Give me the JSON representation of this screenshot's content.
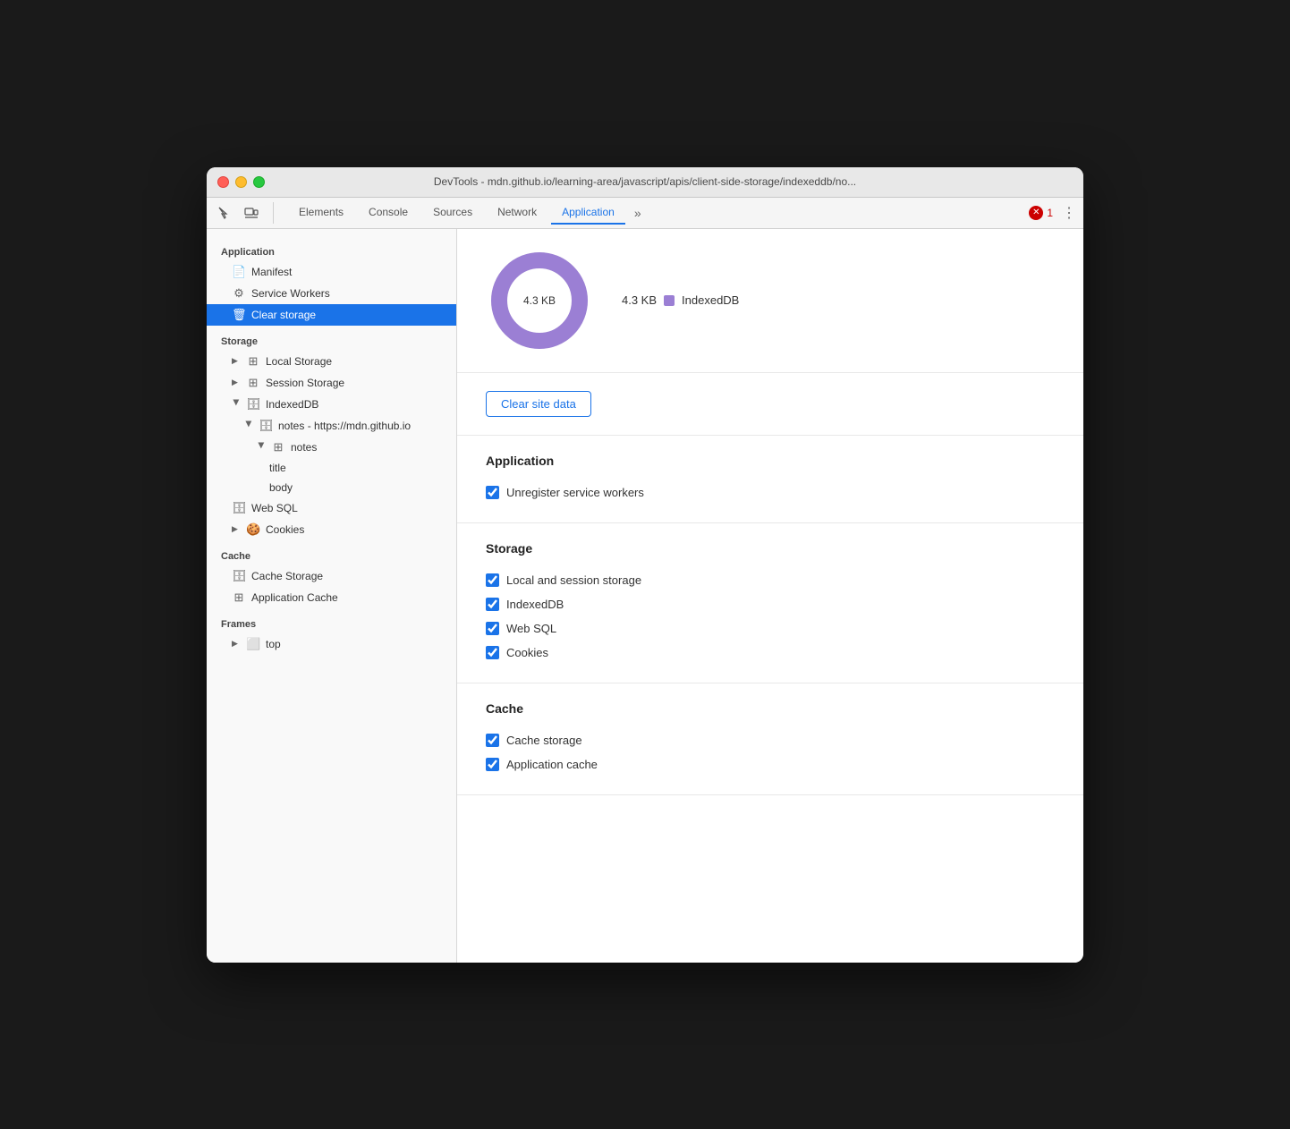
{
  "window": {
    "title": "DevTools - mdn.github.io/learning-area/javascript/apis/client-side-storage/indexeddb/no..."
  },
  "toolbar": {
    "tabs": [
      {
        "id": "elements",
        "label": "Elements",
        "active": false
      },
      {
        "id": "console",
        "label": "Console",
        "active": false
      },
      {
        "id": "sources",
        "label": "Sources",
        "active": false
      },
      {
        "id": "network",
        "label": "Network",
        "active": false
      },
      {
        "id": "application",
        "label": "Application",
        "active": true
      }
    ],
    "more_label": "»",
    "error_count": "1",
    "menu_icon": "⋮"
  },
  "sidebar": {
    "section_application": "Application",
    "manifest_label": "Manifest",
    "service_workers_label": "Service Workers",
    "clear_storage_label": "Clear storage",
    "section_storage": "Storage",
    "local_storage_label": "Local Storage",
    "session_storage_label": "Session Storage",
    "indexeddb_label": "IndexedDB",
    "notes_db_label": "notes - https://mdn.github.io",
    "notes_store_label": "notes",
    "title_field": "title",
    "body_field": "body",
    "websql_label": "Web SQL",
    "cookies_label": "Cookies",
    "section_cache": "Cache",
    "cache_storage_label": "Cache Storage",
    "app_cache_label": "Application Cache",
    "section_frames": "Frames",
    "top_label": "top"
  },
  "chart": {
    "center_label": "4.3 KB",
    "legend": [
      {
        "id": "indexeddb",
        "color": "#9b7fd4",
        "size": "4.3 KB",
        "label": "IndexedDB"
      }
    ]
  },
  "clear_site": {
    "button_label": "Clear site data"
  },
  "settings": {
    "application_title": "Application",
    "checkboxes_application": [
      {
        "id": "unregister_sw",
        "label": "Unregister service workers",
        "checked": true
      }
    ],
    "storage_title": "Storage",
    "checkboxes_storage": [
      {
        "id": "local_session",
        "label": "Local and session storage",
        "checked": true
      },
      {
        "id": "indexeddb",
        "label": "IndexedDB",
        "checked": true
      },
      {
        "id": "websql",
        "label": "Web SQL",
        "checked": true
      },
      {
        "id": "cookies",
        "label": "Cookies",
        "checked": true
      }
    ],
    "cache_title": "Cache",
    "checkboxes_cache": [
      {
        "id": "cache_storage",
        "label": "Cache storage",
        "checked": true
      },
      {
        "id": "app_cache",
        "label": "Application cache",
        "checked": true
      }
    ]
  }
}
